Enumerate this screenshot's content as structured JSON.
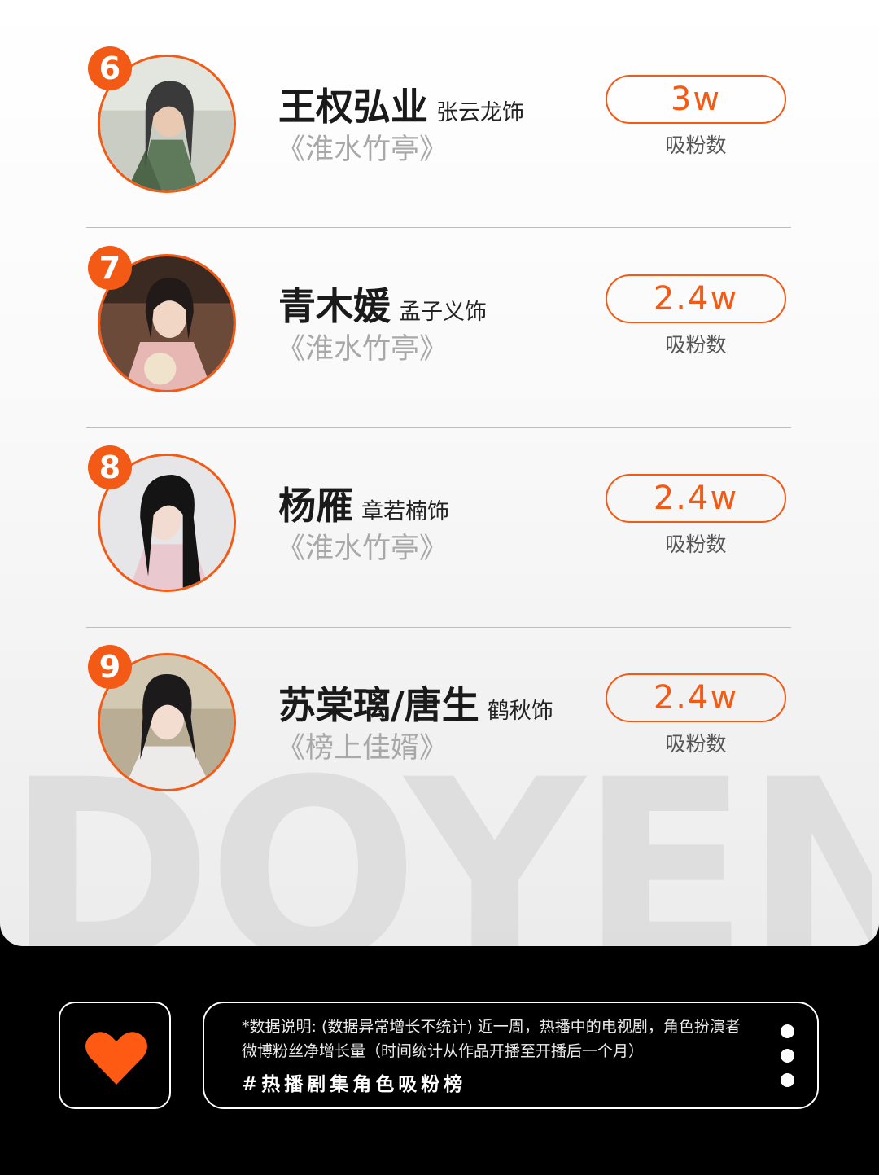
{
  "watermark": "DOYEN",
  "pill_label": "吸粉数",
  "accent_color": "#f25a16",
  "entries": [
    {
      "rank": "6",
      "name": "王权弘业",
      "actor": "张云龙饰",
      "drama": "《淮水竹亭》",
      "fans": "3w"
    },
    {
      "rank": "7",
      "name": "青木媛",
      "actor": "孟子义饰",
      "drama": "《淮水竹亭》",
      "fans": "2.4w"
    },
    {
      "rank": "8",
      "name": "杨雁",
      "actor": "章若楠饰",
      "drama": "《淮水竹亭》",
      "fans": "2.4w"
    },
    {
      "rank": "9",
      "name": "苏棠璃/唐生",
      "actor": "鹤秋饰",
      "drama": "《榜上佳婿》",
      "fans": "2.4w"
    }
  ],
  "footer": {
    "heart_icon": "heart-icon",
    "note": "*数据说明: (数据异常增长不统计) 近一周，热播中的电视剧，角色扮演者微博粉丝净增长量（时间统计从作品开播至开播后一个月）",
    "hashtag": "#热播剧集角色吸粉榜",
    "menu_icon": "more-vertical-icon"
  }
}
